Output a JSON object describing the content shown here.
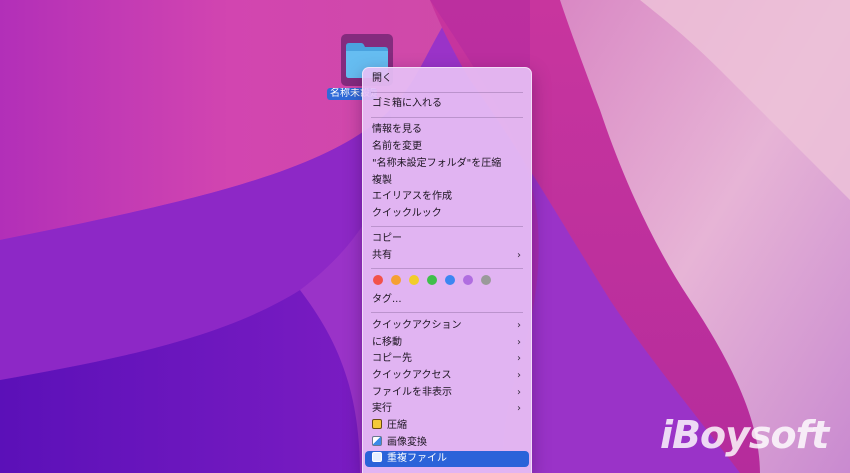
{
  "desktop": {
    "folder_label": "名称未設定フォルダ"
  },
  "menu": {
    "open": "開く",
    "trash": "ゴミ箱に入れる",
    "get_info": "情報を見る",
    "rename": "名前を変更",
    "compress": "\"名称未設定フォルダ\"を圧縮",
    "duplicate": "複製",
    "make_alias": "エイリアスを作成",
    "quick_look": "クイックルック",
    "copy": "コピー",
    "share": "共有",
    "tag_colors": [
      "#f2524a",
      "#f5a033",
      "#f2cd2a",
      "#3fbf4b",
      "#3c86f2",
      "#b06de0",
      "#9a9a9a"
    ],
    "tags": "タグ...",
    "quick_actions": "クイックアクション",
    "move_to": "に移動",
    "copy_to": "コピー先",
    "quick_access": "クイックアクセス",
    "hide_files": "ファイルを非表示",
    "run": "実行",
    "ext_compress": "圧縮",
    "ext_image_convert": "画像変換",
    "ext_duplicate_files": "重複ファイル",
    "submenu_glyph": "›"
  },
  "watermark": "iBoysoft",
  "colors": {
    "selection": "#2b63d9",
    "folder_blue": "#5fb6ef"
  }
}
